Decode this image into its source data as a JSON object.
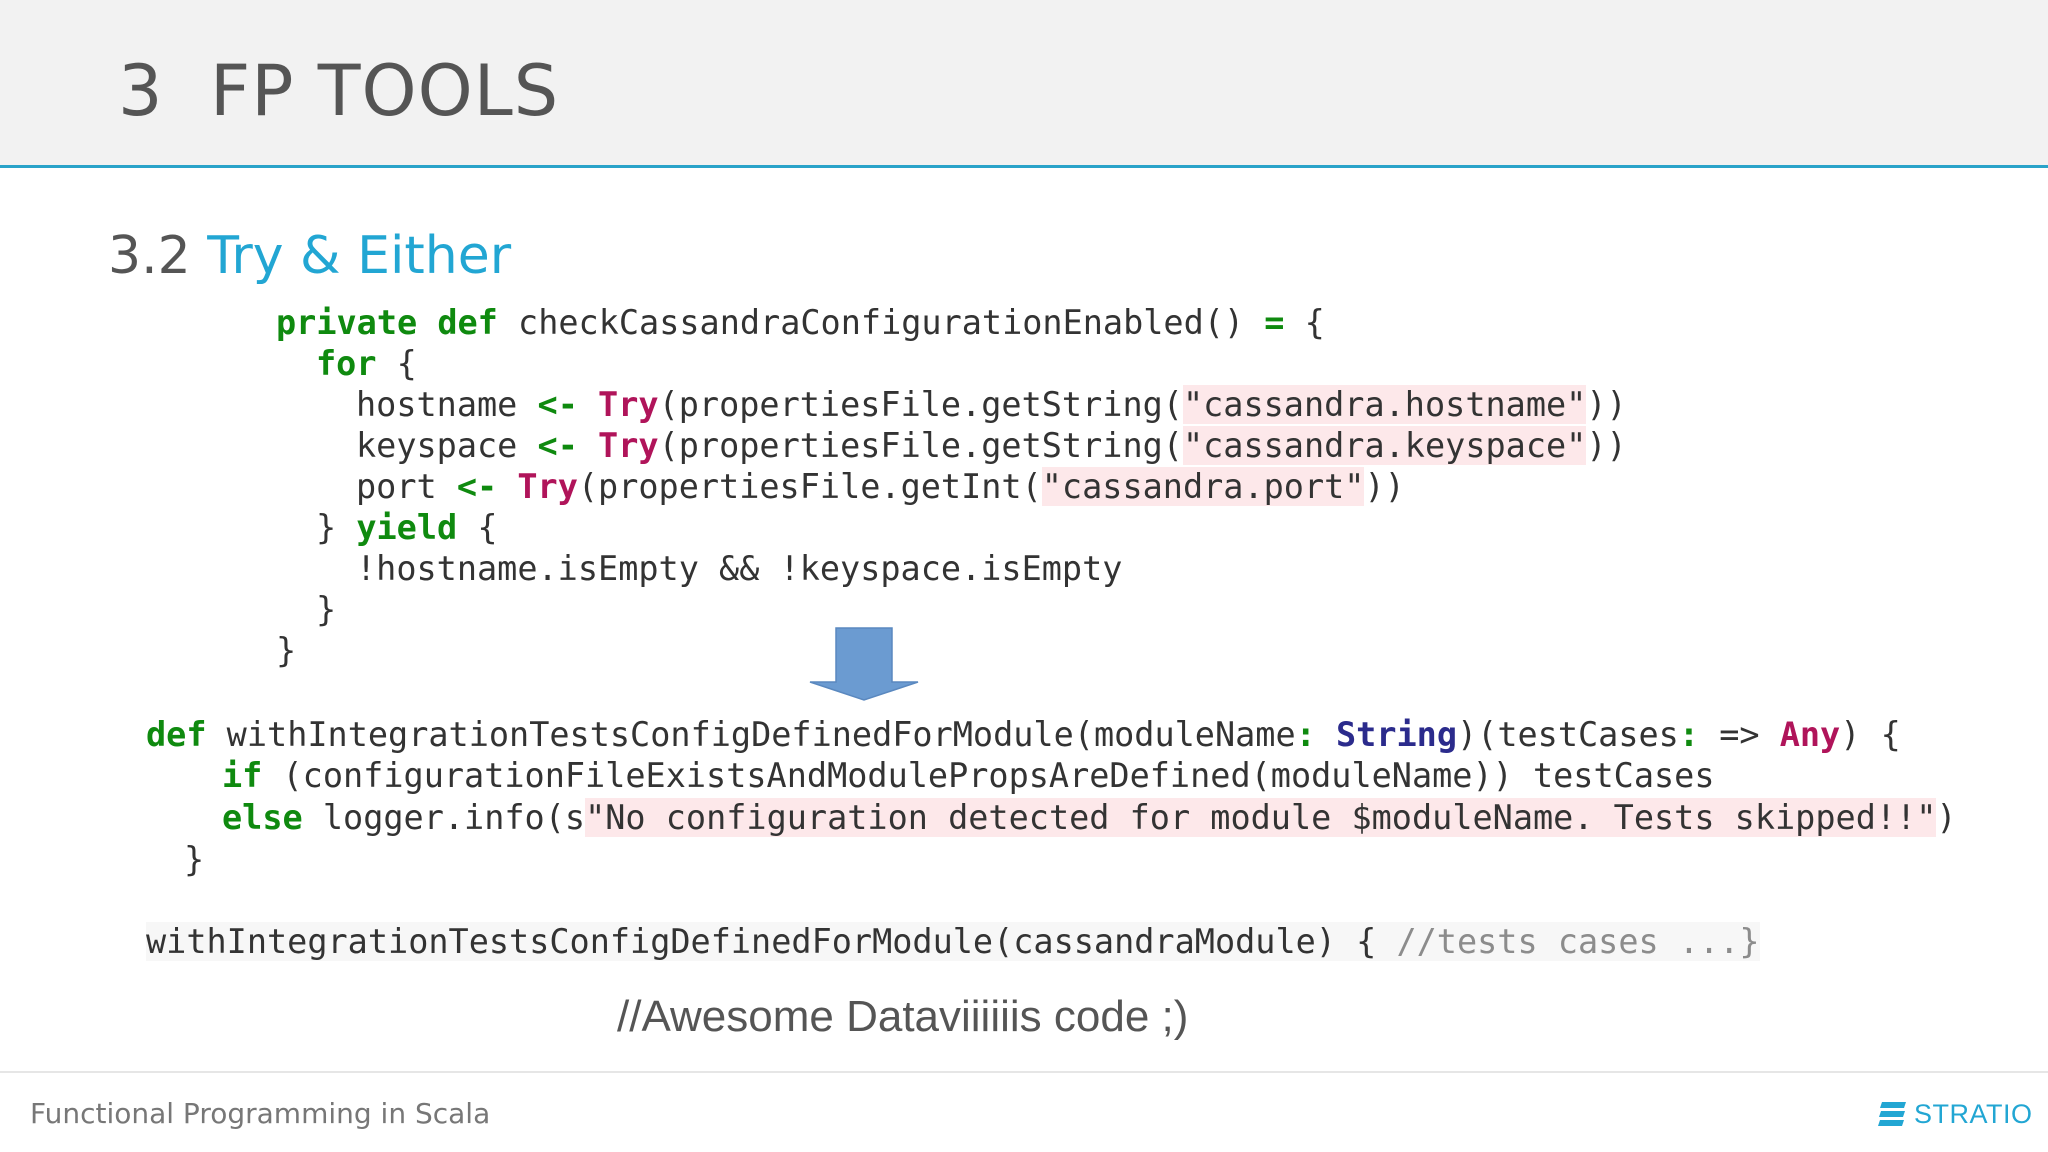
{
  "header": {
    "title": "3  FP TOOLS"
  },
  "section": {
    "number": "3.2 ",
    "title": "Try & Either"
  },
  "code_block_1": {
    "l1_kw": "private def",
    "l1_rest": " checkCassandraConfigurationEnabled() ",
    "l1_eq": "=",
    "l1_end": " {",
    "l2_kw": "for",
    "l2_end": " {",
    "l3_a": "hostname ",
    "l3_arrow": "<-",
    "l3_try": "Try",
    "l3_b": "(propertiesFile.getString(",
    "l3_str": "\"cassandra.hostname\"",
    "l3_c": "))",
    "l4_a": "keyspace ",
    "l4_arrow": "<-",
    "l4_try": "Try",
    "l4_b": "(propertiesFile.getString(",
    "l4_str": "\"cassandra.keyspace\"",
    "l4_c": "))",
    "l5_a": "port ",
    "l5_arrow": "<-",
    "l5_try": "Try",
    "l5_b": "(propertiesFile.getInt(",
    "l5_str": "\"cassandra.port\"",
    "l5_c": "))",
    "l6_a": "} ",
    "l6_kw": "yield",
    "l6_b": " {",
    "l7": "!hostname.isEmpty && !keyspace.isEmpty",
    "l8": "}",
    "l9": "}"
  },
  "code_block_2": {
    "l1_kw": "def",
    "l1_a": " withIntegrationTestsConfigDefinedForModule(moduleName",
    "l1_colon": ":",
    "l1_type1": "String",
    "l1_b": ")(testCases",
    "l1_colon2": ":",
    "l1_c": " => ",
    "l1_type2": "Any",
    "l1_d": ") {",
    "l2_kw": "if",
    "l2_rest": " (configurationFileExistsAndModulePropsAreDefined(moduleName)) testCases",
    "l3_kw": "else",
    "l3_a": " logger.info(s",
    "l3_str": "\"No configuration detected for module $moduleName. Tests skipped!!\"",
    "l3_b": ")",
    "l4": "}",
    "l5_a": "withIntegrationTestsConfigDefinedForModule(cassandraModule) { ",
    "l5_cmt": "//tests cases ...}"
  },
  "caption": "//Awesome Dataviiiiiis code ;)",
  "footer": {
    "text": "Functional Programming in Scala",
    "logo_text": "STRATIO"
  },
  "colors": {
    "accent": "#22a6d3",
    "keyword": "#0f8a0f",
    "try": "#b0145a",
    "type": "#2b2b8c",
    "string_bg": "#fde8ea",
    "arrow": "#6b9bd1"
  }
}
